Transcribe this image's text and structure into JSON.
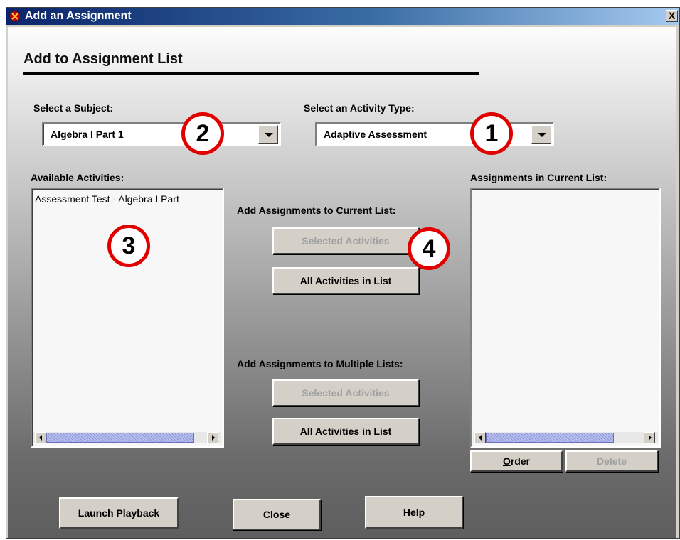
{
  "window": {
    "title": "Add an Assignment",
    "close_label": "X"
  },
  "header": {
    "title": "Add to Assignment List"
  },
  "subject": {
    "label": "Select a Subject:",
    "value": "Algebra I Part 1"
  },
  "activity_type": {
    "label": "Select an Activity Type:",
    "value": "Adaptive Assessment"
  },
  "available": {
    "label": "Available Activities:",
    "items": [
      "Assessment Test - Algebra I Part"
    ]
  },
  "current_list": {
    "label": "Assignments in Current List:"
  },
  "add_current": {
    "label": "Add Assignments to Current List:",
    "selected_label": "Selected Activities",
    "all_label": "All Activities in List"
  },
  "add_multiple": {
    "label": "Add Assignments to Multiple Lists:",
    "selected_label": "Selected Activities",
    "all_label": "All Activities in List"
  },
  "list_actions": {
    "order_mnemonic": "O",
    "order_rest": "rder",
    "delete_label": "Delete"
  },
  "footer": {
    "launch_label": "Launch Playback",
    "close_mnemonic": "C",
    "close_rest": "lose",
    "help_mnemonic": "H",
    "help_rest": "elp"
  },
  "callouts": [
    "1",
    "2",
    "3",
    "4"
  ],
  "icons": {
    "app": "red-app-icon",
    "close": "close-icon",
    "dropdown": "chevron-down-icon",
    "scroll_left": "scroll-left-icon",
    "scroll_right": "scroll-right-icon"
  },
  "colors": {
    "callout_ring": "#e00000",
    "titlebar": "#0a246a",
    "scroll_thumb": "#9aa2e0"
  }
}
